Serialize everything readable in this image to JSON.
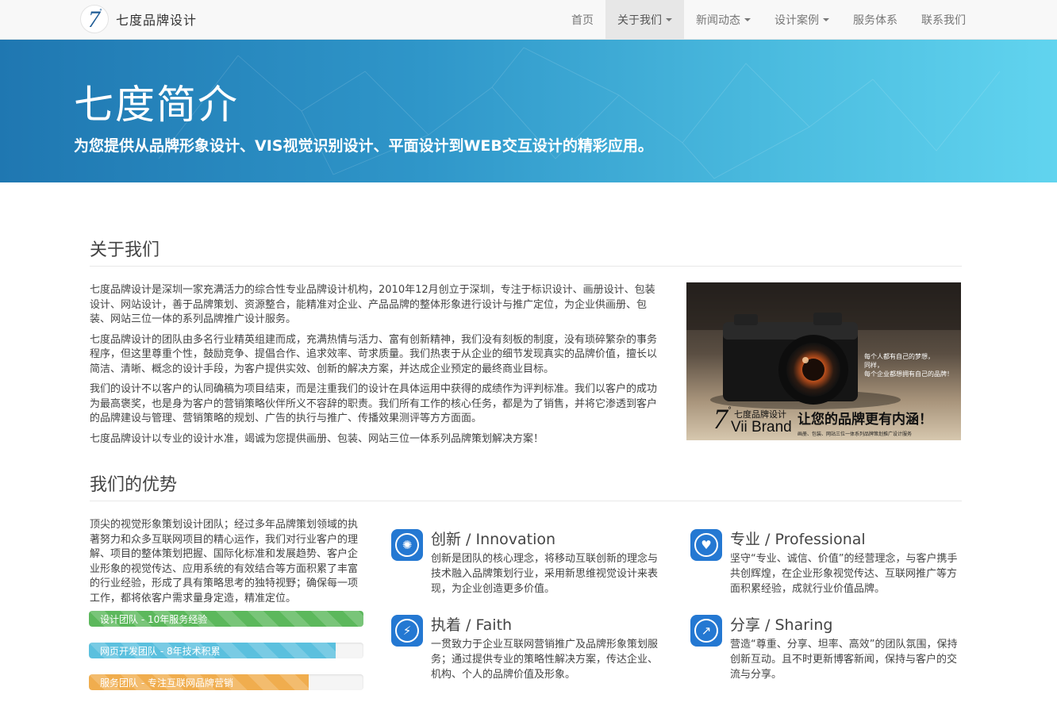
{
  "brand": {
    "logo_text": "7",
    "logo_deg": "°",
    "name": "七度品牌设计"
  },
  "nav": [
    {
      "label": "首页",
      "dropdown": false,
      "active": false
    },
    {
      "label": "关于我们",
      "dropdown": true,
      "active": true
    },
    {
      "label": "新闻动态",
      "dropdown": true,
      "active": false
    },
    {
      "label": "设计案例",
      "dropdown": true,
      "active": false
    },
    {
      "label": "服务体系",
      "dropdown": false,
      "active": false
    },
    {
      "label": "联系我们",
      "dropdown": false,
      "active": false
    }
  ],
  "hero": {
    "title": "七度简介",
    "subtitle": "为您提供从品牌形象设计、VIS视觉识别设计、平面设计到WEB交互设计的精彩应用。"
  },
  "about": {
    "heading": "关于我们",
    "paragraphs": [
      "七度品牌设计是深圳一家充满活力的综合性专业品牌设计机构，2010年12月创立于深圳，专注于标识设计、画册设计、包装设计、网站设计，善于品牌策划、资源整合，能精准对企业、产品品牌的整体形象进行设计与推广定位，为企业供画册、包装、网站三位一体的系列品牌推广设计服务。",
      "七度品牌设计的团队由多名行业精英组建而成，充满热情与活力、富有创新精神，我们没有刻板的制度，没有琐碎繁杂的事务程序，但这里尊重个性，鼓励竞争、提倡合作、追求效率、苛求质量。我们热衷于从企业的细节发现真实的品牌价值，擅长以简洁、清晰、概念的设计手段，为客户提供实效、创新的解决方案，并达成企业预定的最终商业目标。",
      "我们的设计不以客户的认同确稿为项目结束，而是注重我们的设计在具体运用中获得的成绩作为评判标准。我们以客户的成功为最高褒奖，也是身为客户的营销策略伙伴所义不容辞的职责。我们所有工作的核心任务，都是为了销售，并将它渗透到客户的品牌建设与管理、营销策略的规划、广告的执行与推广、传播效果测评等方方面面。",
      "七度品牌设计以专业的设计水准，竭诚为您提供画册、包装、网站三位一体系列品牌策划解决方案！"
    ],
    "image": {
      "slogan_small": "每个人都有自己的梦想，\n同样，\n每个企业都想拥有自己的品牌！",
      "logo_7": "7",
      "logo_deg": "°",
      "brand_cn": "七度品牌设计",
      "brand_en": "Vii Brand",
      "slogan_big": "让您的品牌更有内涵！",
      "footer": "画册、包装、网站三位一体系列品牌策划推广设计服务"
    }
  },
  "advantages": {
    "heading": "我们的优势",
    "intro": "顶尖的视觉形象策划设计团队；经过多年品牌策划领域的执著努力和众多互联网项目的精心运作，我们对行业客户的理解、项目的整体策划把握、国际化标准和发展趋势、客户企业形象的视觉传达、应用系统的有效结合等方面积累了丰富的行业经验，形成了具有策略思考的独特视野；确保每一项工作，都将依客户需求量身定造，精准定位。",
    "bars": [
      {
        "label": "设计团队 - 10年服务经验",
        "percent": 100,
        "color": "#5cb85c"
      },
      {
        "label": "网页开发团队 - 8年技术积累",
        "percent": 90,
        "color": "#5bc0de"
      },
      {
        "label": "服务团队 - 专注互联网品牌营销",
        "percent": 80,
        "color": "#f0ad4e"
      }
    ],
    "features": [
      {
        "title": "创新 / Innovation",
        "icon": "lightbulb-icon",
        "glyph": "✺",
        "desc": "创新是团队的核心理念，将移动互联创新的理念与技术融入品牌策划行业，采用新思维视觉设计来表现，为企业创造更多价值。"
      },
      {
        "title": "专业 / Professional",
        "icon": "tulip-icon",
        "glyph": "♥",
        "desc": "坚守“专业、诚信、价值”的经营理念，与客户携手共创辉煌，在企业形象视觉传达、互联网推广等方面积累经验，成就行业价值品牌。"
      },
      {
        "title": "执着 / Faith",
        "icon": "lightning-icon",
        "glyph": "⚡",
        "desc": "一贯致力于企业互联网营销推广及品牌形象策划服务；通过提供专业的策略性解决方案，传达企业、机构、个人的品牌价值及形象。"
      },
      {
        "title": "分享 / Sharing",
        "icon": "share-icon",
        "glyph": "↗",
        "desc": "营造“尊重、分享、坦率、高效”的团队氛围，保持创新互动。且不时更新博客新闻，保持与客户的交流与分享。"
      }
    ]
  }
}
